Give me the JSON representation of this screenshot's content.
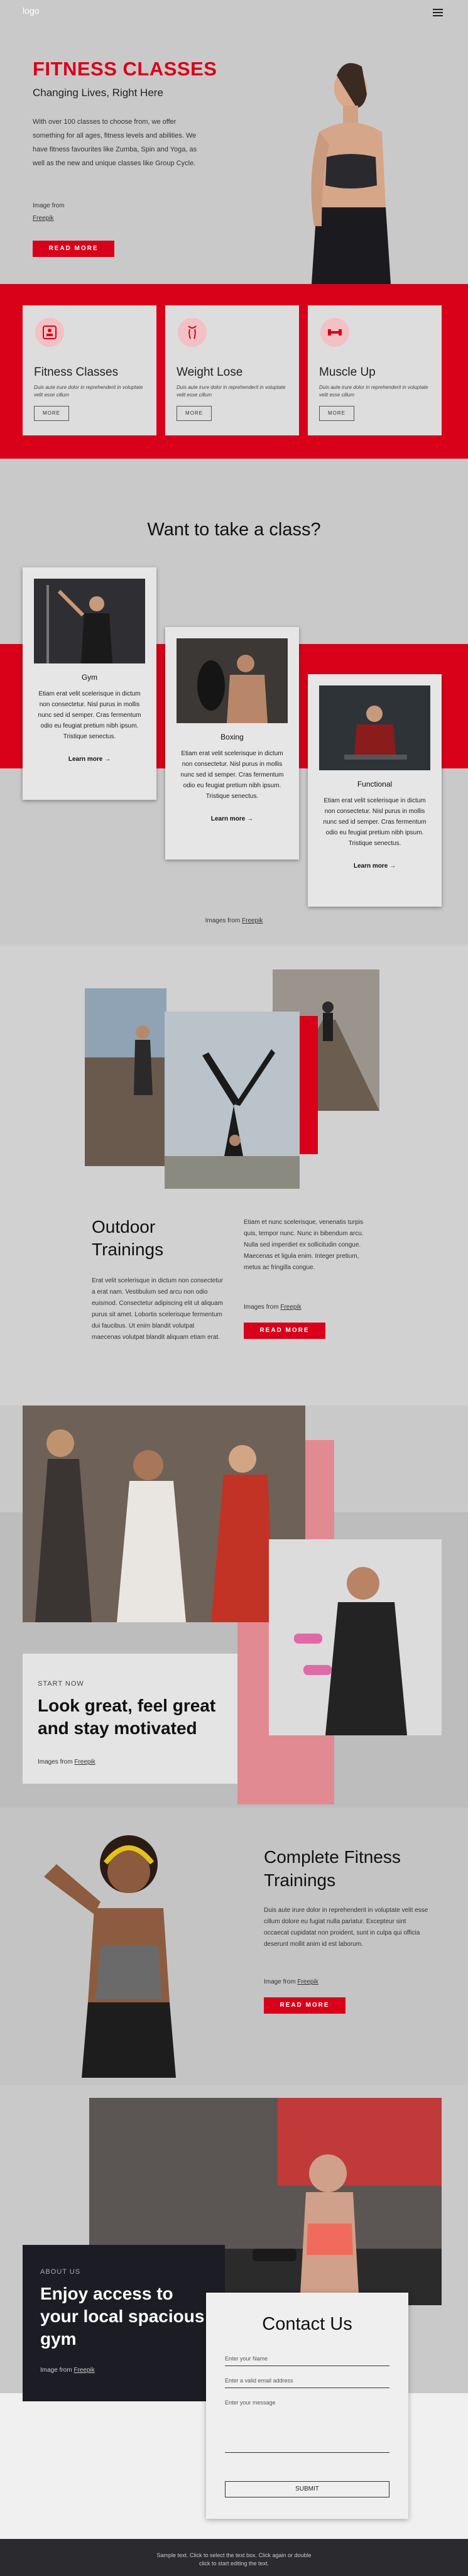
{
  "header": {
    "logo": "logo"
  },
  "hero": {
    "title": "FITNESS CLASSES",
    "subtitle": "Changing Lives, Right Here",
    "description": "With over 100 classes to choose from, we offer something for all ages, fitness levels and abilities. We have fitness favourites like Zumba, Spin and Yoga, as well as the new and unique classes like Group Cycle.",
    "credit_prefix": "Image from",
    "credit_link": "Freepik",
    "button": "READ MORE"
  },
  "features": [
    {
      "title": "Fitness Classes",
      "desc": "Duis aute irure dolor in reprehenderit in voluptate velit esse cillum",
      "button": "MORE"
    },
    {
      "title": "Weight Lose",
      "desc": "Duis aute irure dolor in reprehenderit in voluptate velit esse cillum",
      "button": "MORE"
    },
    {
      "title": "Muscle Up",
      "desc": "Duis aute irure dolor in reprehenderit in voluptate velit esse cillum",
      "button": "MORE"
    }
  ],
  "classes": {
    "title": "Want to take a class?",
    "items": [
      {
        "title": "Gym",
        "desc": "Etiam erat velit scelerisque in dictum non consectetur. Nisl purus in mollis nunc sed id semper. Cras fermentum odio eu feugiat pretium nibh ipsum. Tristique senectus.",
        "link": "Learn more →"
      },
      {
        "title": "Boxing",
        "desc": "Etiam erat velit scelerisque in dictum non consectetur. Nisl purus in mollis nunc sed id semper. Cras fermentum odio eu feugiat pretium nibh ipsum. Tristique senectus.",
        "link": "Learn more →"
      },
      {
        "title": "Functional",
        "desc": "Etiam erat velit scelerisque in dictum non consectetur. Nisl purus in mollis nunc sed id semper. Cras fermentum odio eu feugiat pretium nibh ipsum. Tristique senectus.",
        "link": "Learn more →"
      }
    ],
    "credit_prefix": "Images from",
    "credit_link": "Freepik"
  },
  "outdoor": {
    "title": "Outdoor Trainings",
    "left_text": "Erat velit scelerisque in dictum non consectetur a erat nam. Vestibulum sed arcu non odio euismod. Consectetur adipiscing elit ut aliquam purus sit amet. Lobortis scelerisque fermentum dui faucibus. Ut enim blandit volutpat maecenas volutpat blandit aliquam etiam erat.",
    "right_text": "Etiam et nunc scelerisque, venenatis turpis quis, tempor nunc. Nunc in bibendum arcu. Nulla sed imperdiet ex sollicitudin congue. Maecenas et ligula enim. Integer pretium, metus ac fringilla congue.",
    "credit_prefix": "Images from",
    "credit_link": "Freepik",
    "button": "READ MORE"
  },
  "motivation": {
    "small": "START NOW",
    "title": "Look great, feel great and stay motivated",
    "credit_prefix": "Images from",
    "credit_link": "Freepik"
  },
  "complete": {
    "title": "Complete Fitness Trainings",
    "description": "Duis aute irure dolor in reprehenderit in voluptate velit esse cillum dolore eu fugiat nulla pariatur. Excepteur sint occaecat cupidatat non proident, sunt in culpa qui officia deserunt mollit anim id est laborum.",
    "credit_prefix": "Image from",
    "credit_link": "Freepik",
    "button": "READ MORE"
  },
  "about": {
    "small": "ABOUT US",
    "title": "Enjoy access to your local spacious gym",
    "credit_prefix": "Image from",
    "credit_link": "Freepik"
  },
  "contact": {
    "title": "Contact Us",
    "name_placeholder": "Enter your Name",
    "email_placeholder": "Enter a valid email address",
    "message_placeholder": "Enter your message",
    "submit": "SUBMIT"
  },
  "footer": {
    "line1": "Sample text. Click to select the text box. Click again or double",
    "line2": "click to start editing the text."
  },
  "colors": {
    "accent": "#d9001a",
    "background": "#c9c9c9",
    "dark": "#1c1c24"
  }
}
